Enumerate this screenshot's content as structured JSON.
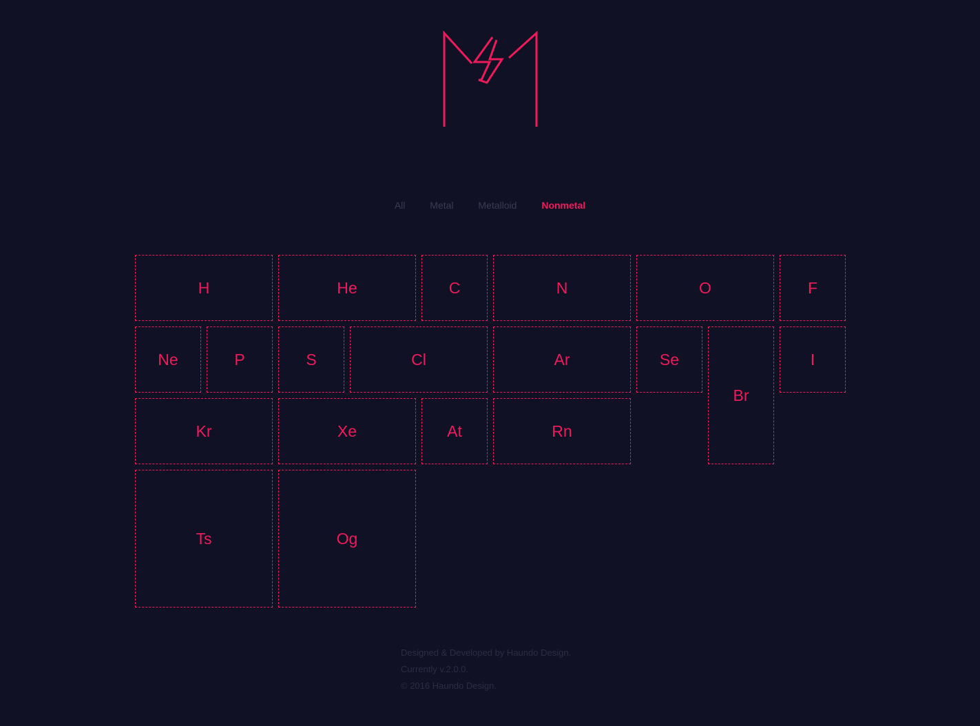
{
  "logo": {
    "name": "M-lightning logo",
    "color": "#ee1b5a"
  },
  "filters": [
    {
      "label": "All",
      "active": false
    },
    {
      "label": "Metal",
      "active": false
    },
    {
      "label": "Metalloid",
      "active": false
    },
    {
      "label": "Nonmetal",
      "active": true
    }
  ],
  "elements": [
    {
      "symbol": "H"
    },
    {
      "symbol": "He"
    },
    {
      "symbol": "C"
    },
    {
      "symbol": "N"
    },
    {
      "symbol": "O"
    },
    {
      "symbol": "F"
    },
    {
      "symbol": "Ne"
    },
    {
      "symbol": "P"
    },
    {
      "symbol": "S"
    },
    {
      "symbol": "Cl"
    },
    {
      "symbol": "Ar"
    },
    {
      "symbol": "Se"
    },
    {
      "symbol": "Br"
    },
    {
      "symbol": "I"
    },
    {
      "symbol": "Kr"
    },
    {
      "symbol": "Xe"
    },
    {
      "symbol": "At"
    },
    {
      "symbol": "Rn"
    },
    {
      "symbol": "Ts"
    },
    {
      "symbol": "Og"
    }
  ],
  "footer": {
    "line1": "Designed & Developed by Haundo Design.",
    "line2": "Currently v.2.0.0.",
    "line3": "© 2016 Haundo Design."
  },
  "colors": {
    "background": "#101124",
    "accent": "#ee1b5a",
    "muted": "#3a3b55"
  }
}
